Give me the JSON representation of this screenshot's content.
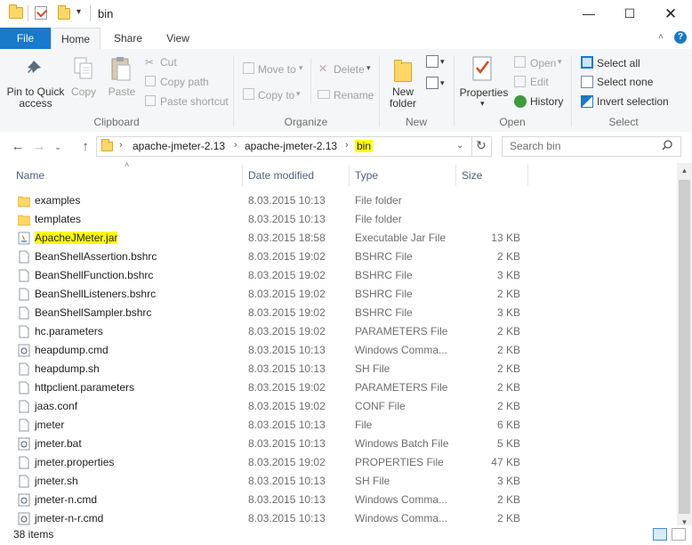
{
  "window": {
    "title": "bin",
    "minimize_icon": "minimize-icon",
    "maximize_icon": "maximize-icon",
    "close_icon": "close-icon"
  },
  "ribbon_tabs": {
    "file": "File",
    "home": "Home",
    "share": "Share",
    "view": "View"
  },
  "ribbon": {
    "clipboard": {
      "pin_line1": "Pin to Quick",
      "pin_line2": "access",
      "copy": "Copy",
      "paste": "Paste",
      "cut": "Cut",
      "copy_path": "Copy path",
      "paste_shortcut": "Paste shortcut",
      "label": "Clipboard"
    },
    "organize": {
      "move_to": "Move to",
      "copy_to": "Copy to",
      "delete": "Delete",
      "rename": "Rename",
      "label": "Organize"
    },
    "new": {
      "new_folder_line1": "New",
      "new_folder_line2": "folder",
      "label": "New"
    },
    "open": {
      "properties": "Properties",
      "open": "Open",
      "edit": "Edit",
      "history": "History",
      "label": "Open"
    },
    "select": {
      "select_all": "Select all",
      "select_none": "Select none",
      "invert_selection": "Invert selection",
      "label": "Select"
    }
  },
  "address": {
    "crumbs": [
      "apache-jmeter-2.13",
      "apache-jmeter-2.13",
      "bin"
    ],
    "search_placeholder": "Search bin"
  },
  "columns": {
    "name": "Name",
    "date_modified": "Date modified",
    "type": "Type",
    "size": "Size"
  },
  "files": [
    {
      "name": "examples",
      "date": "8.03.2015 10:13",
      "type": "File folder",
      "size": "",
      "icon": "folder-icon"
    },
    {
      "name": "templates",
      "date": "8.03.2015 10:13",
      "type": "File folder",
      "size": "",
      "icon": "folder-icon"
    },
    {
      "name": "ApacheJMeter.jar",
      "date": "8.03.2015 18:58",
      "type": "Executable Jar File",
      "size": "13 KB",
      "icon": "jar-icon"
    },
    {
      "name": "BeanShellAssertion.bshrc",
      "date": "8.03.2015 19:02",
      "type": "BSHRC File",
      "size": "2 KB",
      "icon": "file-icon"
    },
    {
      "name": "BeanShellFunction.bshrc",
      "date": "8.03.2015 19:02",
      "type": "BSHRC File",
      "size": "3 KB",
      "icon": "file-icon"
    },
    {
      "name": "BeanShellListeners.bshrc",
      "date": "8.03.2015 19:02",
      "type": "BSHRC File",
      "size": "2 KB",
      "icon": "file-icon"
    },
    {
      "name": "BeanShellSampler.bshrc",
      "date": "8.03.2015 19:02",
      "type": "BSHRC File",
      "size": "3 KB",
      "icon": "file-icon"
    },
    {
      "name": "hc.parameters",
      "date": "8.03.2015 19:02",
      "type": "PARAMETERS File",
      "size": "2 KB",
      "icon": "file-icon"
    },
    {
      "name": "heapdump.cmd",
      "date": "8.03.2015 10:13",
      "type": "Windows Comma...",
      "size": "2 KB",
      "icon": "cmd-icon"
    },
    {
      "name": "heapdump.sh",
      "date": "8.03.2015 10:13",
      "type": "SH File",
      "size": "2 KB",
      "icon": "file-icon"
    },
    {
      "name": "httpclient.parameters",
      "date": "8.03.2015 19:02",
      "type": "PARAMETERS File",
      "size": "2 KB",
      "icon": "file-icon"
    },
    {
      "name": "jaas.conf",
      "date": "8.03.2015 19:02",
      "type": "CONF File",
      "size": "2 KB",
      "icon": "file-icon"
    },
    {
      "name": "jmeter",
      "date": "8.03.2015 10:13",
      "type": "File",
      "size": "6 KB",
      "icon": "file-icon"
    },
    {
      "name": "jmeter.bat",
      "date": "8.03.2015 10:13",
      "type": "Windows Batch File",
      "size": "5 KB",
      "icon": "cmd-icon"
    },
    {
      "name": "jmeter.properties",
      "date": "8.03.2015 19:02",
      "type": "PROPERTIES File",
      "size": "47 KB",
      "icon": "file-icon"
    },
    {
      "name": "jmeter.sh",
      "date": "8.03.2015 10:13",
      "type": "SH File",
      "size": "3 KB",
      "icon": "file-icon"
    },
    {
      "name": "jmeter-n.cmd",
      "date": "8.03.2015 10:13",
      "type": "Windows Comma...",
      "size": "2 KB",
      "icon": "cmd-icon"
    },
    {
      "name": "jmeter-n-r.cmd",
      "date": "8.03.2015 10:13",
      "type": "Windows Comma...",
      "size": "2 KB",
      "icon": "cmd-icon"
    }
  ],
  "highlighted_file": "ApacheJMeter.jar",
  "status": {
    "item_count": "38 items"
  },
  "colors": {
    "file_tab": "#1979ca",
    "highlight": "#ffff00",
    "folder": "#ffd766"
  }
}
